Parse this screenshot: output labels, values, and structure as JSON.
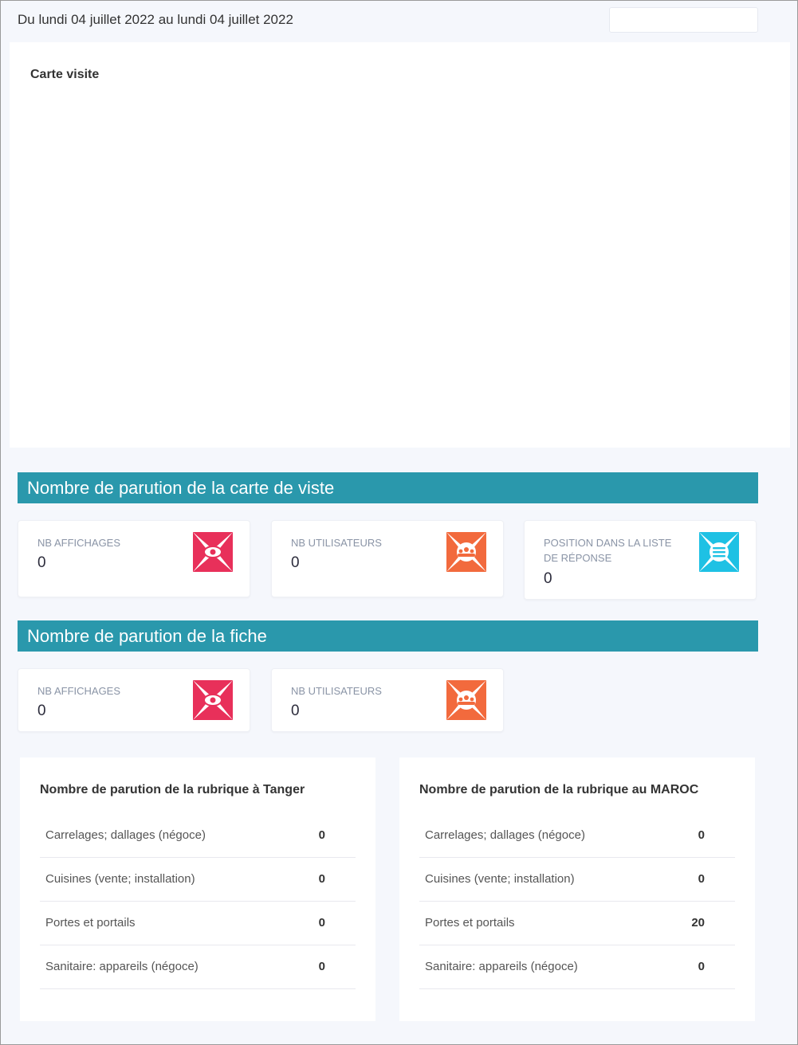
{
  "header": {
    "date_range": "Du lundi 04 juillet 2022 au lundi 04 juillet 2022",
    "date_input_value": ""
  },
  "map": {
    "title": "Carte visite"
  },
  "section_carte": {
    "title": "Nombre de parution de la carte de viste",
    "cards": [
      {
        "label": "NB AFFICHAGES",
        "value": "0",
        "icon": "eye-icon",
        "color": "#e8305a"
      },
      {
        "label": "NB UTILISATEURS",
        "value": "0",
        "icon": "users-icon",
        "color": "#f26a3d"
      },
      {
        "label": "POSITION DANS LA LISTE DE RÉPONSE",
        "value": "0",
        "icon": "list-icon",
        "color": "#1ec1e4"
      }
    ]
  },
  "section_fiche": {
    "title": "Nombre de parution de la fiche",
    "cards": [
      {
        "label": "NB AFFICHAGES",
        "value": "0",
        "icon": "eye-icon",
        "color": "#e8305a"
      },
      {
        "label": "NB UTILISATEURS",
        "value": "0",
        "icon": "users-icon",
        "color": "#f26a3d"
      }
    ]
  },
  "table_tanger": {
    "title": "Nombre de parution de la rubrique à Tanger",
    "rows": [
      {
        "name": "Carrelages; dallages (négoce)",
        "value": "0"
      },
      {
        "name": "Cuisines (vente; installation)",
        "value": "0"
      },
      {
        "name": "Portes et portails",
        "value": "0"
      },
      {
        "name": "Sanitaire: appareils (négoce)",
        "value": "0"
      }
    ]
  },
  "table_maroc": {
    "title": "Nombre de parution de la rubrique au MAROC",
    "rows": [
      {
        "name": "Carrelages; dallages (négoce)",
        "value": "0"
      },
      {
        "name": "Cuisines (vente; installation)",
        "value": "0"
      },
      {
        "name": "Portes et portails",
        "value": "20"
      },
      {
        "name": "Sanitaire: appareils (négoce)",
        "value": "0"
      }
    ]
  }
}
